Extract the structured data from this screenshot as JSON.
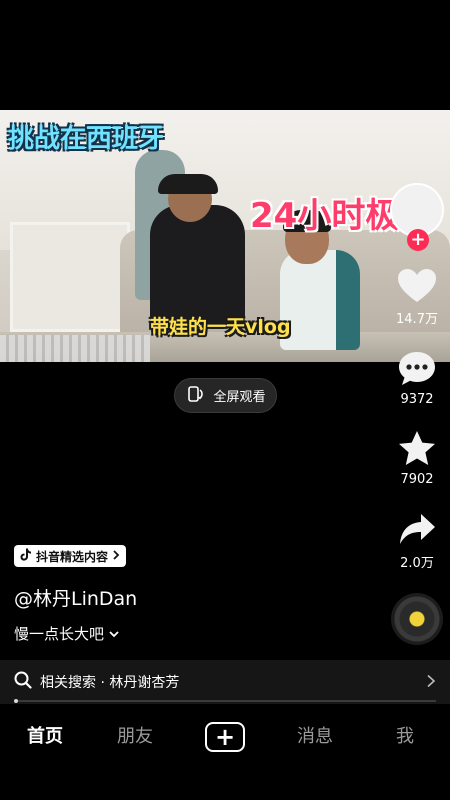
{
  "video": {
    "overlay_title": "挑战在西班牙",
    "overlay_hours": "24小时极",
    "overlay_vlog": "带娃的一天vlog"
  },
  "fullscreen": {
    "label": "全屏观看",
    "icon": "rotate-screen-icon"
  },
  "actions": {
    "likes": "14.7万",
    "comments": "9372",
    "favorites": "7902",
    "shares": "2.0万"
  },
  "post": {
    "badge": "抖音精选内容",
    "author": "@林丹LinDan",
    "caption": "慢一点长大吧"
  },
  "related_search": {
    "prefix": "相关搜索",
    "separator": "·",
    "query": "林丹谢杏芳"
  },
  "progress": {
    "value": 0.01
  },
  "tabs": {
    "home": "首页",
    "friends": "朋友",
    "create": "+",
    "messages": "消息",
    "me": "我"
  },
  "colors": {
    "accent": "#fe2c55",
    "background": "#000000",
    "disc_center": "#f0d33a"
  }
}
